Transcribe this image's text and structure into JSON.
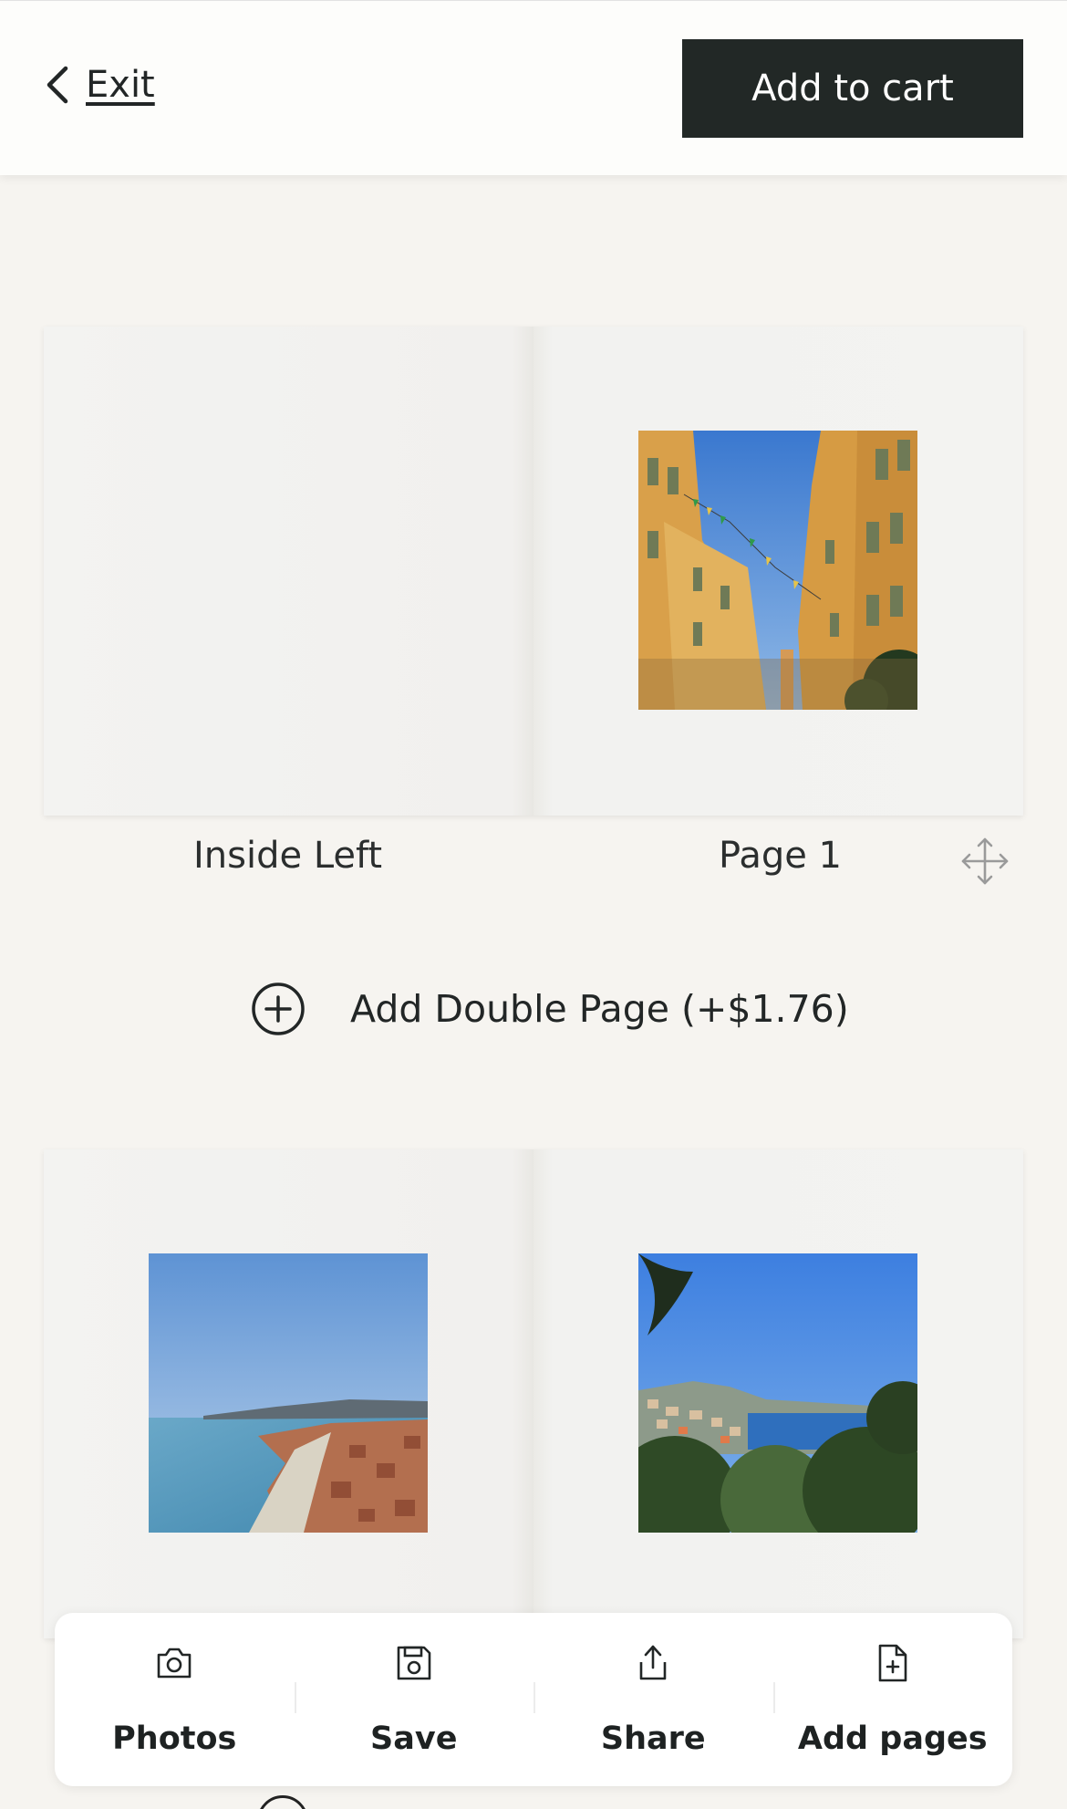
{
  "header": {
    "exit_label": "Exit",
    "cart_label": "Add to cart"
  },
  "spreads": [
    {
      "left_label": "Inside Left",
      "right_label": "Page 1",
      "right_photo": "yellow-buildings-street-bunting-photo"
    },
    {
      "left_photo": "coastline-aerial-city-beach-photo",
      "right_photo": "harbour-hillside-trees-photo"
    }
  ],
  "add_double_page": {
    "label": "Add Double Page (+$1.76)",
    "icon": "plus-circle-icon"
  },
  "toolbar": {
    "items": [
      {
        "label": "Photos",
        "icon": "camera-icon"
      },
      {
        "label": "Save",
        "icon": "floppy-disk-icon"
      },
      {
        "label": "Share",
        "icon": "share-icon"
      },
      {
        "label": "Add pages",
        "icon": "add-file-icon"
      }
    ]
  },
  "colors": {
    "background": "#f6f4f0",
    "header": "#fdfdfb",
    "button_dark": "#222826",
    "paper": "#f3f3f1"
  }
}
